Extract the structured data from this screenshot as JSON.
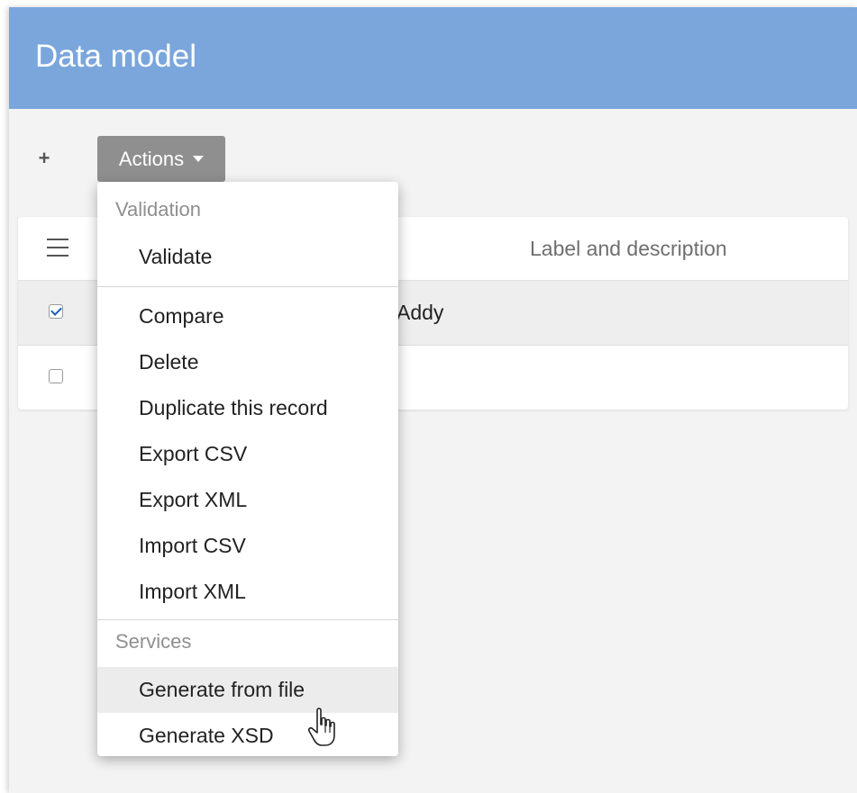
{
  "header": {
    "title": "Data model"
  },
  "toolbar": {
    "add_label": "+",
    "actions_label": "Actions"
  },
  "table": {
    "columns": [
      "Label and description"
    ],
    "rows": [
      {
        "label": "Addy",
        "checked": true
      },
      {
        "label": "",
        "checked": false
      }
    ]
  },
  "dropdown": {
    "sections": [
      {
        "title": "Validation",
        "items": [
          "Validate"
        ]
      },
      {
        "title": "",
        "items": [
          "Compare",
          "Delete",
          "Duplicate this record",
          "Export CSV",
          "Export XML",
          "Import CSV",
          "Import XML"
        ]
      },
      {
        "title": "Services",
        "items": [
          "Generate from file",
          "Generate XSD"
        ]
      }
    ],
    "hovered_item": "Generate from file"
  },
  "colors": {
    "header_bg": "#7aa6dc",
    "actions_bg": "#8f8f8f",
    "check": "#1c5fb5"
  }
}
